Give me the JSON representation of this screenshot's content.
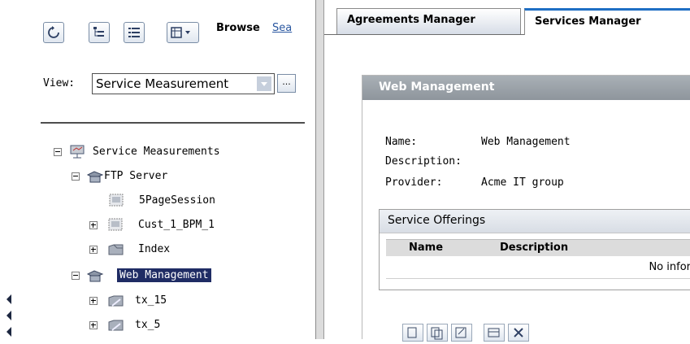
{
  "left_pane": {
    "toolbar": {
      "browse_label": "Browse",
      "search_label": "Sea"
    },
    "view": {
      "label": "View:",
      "value": "Service Measurement",
      "more_button": "..."
    },
    "tree": {
      "nodes": [
        {
          "label": "Service Measurements"
        },
        {
          "label": "FTP Server"
        },
        {
          "label": "5PageSession"
        },
        {
          "label": "Cust_1_BPM_1"
        },
        {
          "label": "Index"
        },
        {
          "label": "Web Management"
        },
        {
          "label": "tx_15"
        },
        {
          "label": "tx_5"
        }
      ]
    }
  },
  "right_pane": {
    "tabs": [
      {
        "label": "Agreements Manager"
      },
      {
        "label": "Services Manager"
      }
    ],
    "panel": {
      "title": "Web Management",
      "fields": [
        {
          "label": "Name:",
          "value": "Web Management"
        },
        {
          "label": "Description:",
          "value": ""
        },
        {
          "label": "Provider:",
          "value": "Acme IT group"
        }
      ],
      "offerings": {
        "title": "Service Offerings",
        "columns": [
          "Name",
          "Description"
        ],
        "empty_text": "No infor"
      }
    }
  },
  "colors": {
    "selected_bg": "#1f2c64",
    "panel_header": "#9aa1a8",
    "active_tab_accent": "#1f6fc4",
    "link": "#2a57a0"
  }
}
